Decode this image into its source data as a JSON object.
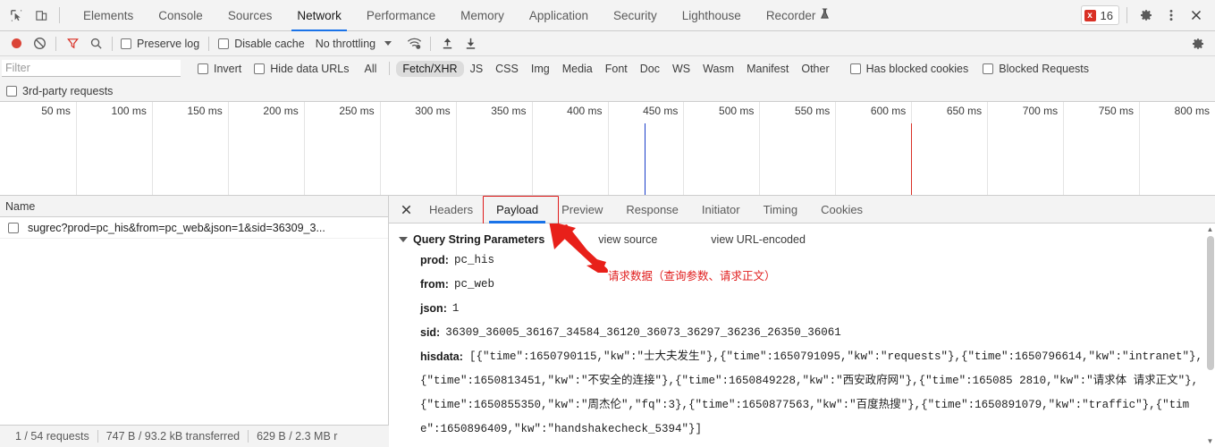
{
  "main_tabs": [
    {
      "label": "Elements",
      "active": false
    },
    {
      "label": "Console",
      "active": false
    },
    {
      "label": "Sources",
      "active": false
    },
    {
      "label": "Network",
      "active": true
    },
    {
      "label": "Performance",
      "active": false
    },
    {
      "label": "Memory",
      "active": false
    },
    {
      "label": "Application",
      "active": false
    },
    {
      "label": "Security",
      "active": false
    },
    {
      "label": "Lighthouse",
      "active": false
    },
    {
      "label": "Recorder",
      "active": false
    }
  ],
  "tabbar_right": {
    "error_count": "16",
    "error_glyph": "x",
    "settings_icon": "gear-icon",
    "more_icon": "kebab-menu-icon",
    "close_icon": "close-icon"
  },
  "network_toolbar": {
    "record_icon": "record-dot-icon",
    "clear_icon": "clear-no-entry-icon",
    "filter_icon": "funnel-icon",
    "search_icon": "search-icon",
    "preserve_log": "Preserve log",
    "disable_cache": "Disable cache",
    "throttling": "No throttling",
    "network_conditions_icon": "wifi-settings-icon",
    "import_icon": "upload-arrow-icon",
    "export_icon": "download-arrow-icon",
    "settings_icon": "gear-icon"
  },
  "filter_bar": {
    "placeholder": "Filter",
    "value": "",
    "invert": "Invert",
    "hide_data_urls": "Hide data URLs",
    "types": [
      {
        "label": "All",
        "active": false
      },
      {
        "label": "Fetch/XHR",
        "active": true
      },
      {
        "label": "JS",
        "active": false
      },
      {
        "label": "CSS",
        "active": false
      },
      {
        "label": "Img",
        "active": false
      },
      {
        "label": "Media",
        "active": false
      },
      {
        "label": "Font",
        "active": false
      },
      {
        "label": "Doc",
        "active": false
      },
      {
        "label": "WS",
        "active": false
      },
      {
        "label": "Wasm",
        "active": false
      },
      {
        "label": "Manifest",
        "active": false
      },
      {
        "label": "Other",
        "active": false
      }
    ],
    "has_blocked_cookies": "Has blocked cookies",
    "blocked_requests": "Blocked Requests",
    "third_party_requests": "3rd-party requests"
  },
  "overview": {
    "ticks": [
      "50 ms",
      "100 ms",
      "150 ms",
      "200 ms",
      "250 ms",
      "300 ms",
      "350 ms",
      "400 ms",
      "450 ms",
      "500 ms",
      "550 ms",
      "600 ms",
      "650 ms",
      "700 ms",
      "750 ms",
      "800 ms"
    ],
    "dom_content_loaded_color": "#1a3ec8",
    "load_event_color": "#d93025",
    "selection_color": "#1a73e8"
  },
  "request_list": {
    "column_name": "Name",
    "rows": [
      {
        "name": "sugrec?prod=pc_his&from=pc_web&json=1&sid=36309_3..."
      }
    ]
  },
  "details": {
    "close_icon": "close-icon",
    "tabs": [
      {
        "label": "Headers",
        "active": false
      },
      {
        "label": "Payload",
        "active": true
      },
      {
        "label": "Preview",
        "active": false
      },
      {
        "label": "Response",
        "active": false
      },
      {
        "label": "Initiator",
        "active": false
      },
      {
        "label": "Timing",
        "active": false
      },
      {
        "label": "Cookies",
        "active": false
      }
    ],
    "section_title": "Query String Parameters",
    "view_source": "view source",
    "view_url_encoded": "view URL-encoded",
    "params": [
      {
        "key": "prod:",
        "value": "pc_his"
      },
      {
        "key": "from:",
        "value": "pc_web"
      },
      {
        "key": "json:",
        "value": "1"
      },
      {
        "key": "sid:",
        "value": "36309_36005_36167_34584_36120_36073_36297_36236_26350_36061"
      }
    ],
    "hisdata_key": "hisdata:",
    "hisdata_value": "[{\"time\":1650790115,\"kw\":\"士大夫发生\"},{\"time\":1650791095,\"kw\":\"requests\"},{\"time\":1650796614,\"kw\":\"intranet\"},{\"time\":1650813451,\"kw\":\"不安全的连接\"},{\"time\":1650849228,\"kw\":\"西安政府网\"},{\"time\":165085 2810,\"kw\":\"请求体 请求正文\"},{\"time\":1650855350,\"kw\":\"周杰伦\",\"fq\":3},{\"time\":1650877563,\"kw\":\"百度热搜\"},{\"time\":1650891079,\"kw\":\"traffic\"},{\"time\":1650896409,\"kw\":\"handshakecheck_5394\"}]"
  },
  "annotations": {
    "callout_text": "请求数据（查询参数、请求正文）",
    "color": "#e01b1b"
  },
  "statusbar": {
    "requests": "1 / 54 requests",
    "transferred": "747 B / 93.2 kB transferred",
    "resources": "629 B / 2.3 MB r"
  }
}
